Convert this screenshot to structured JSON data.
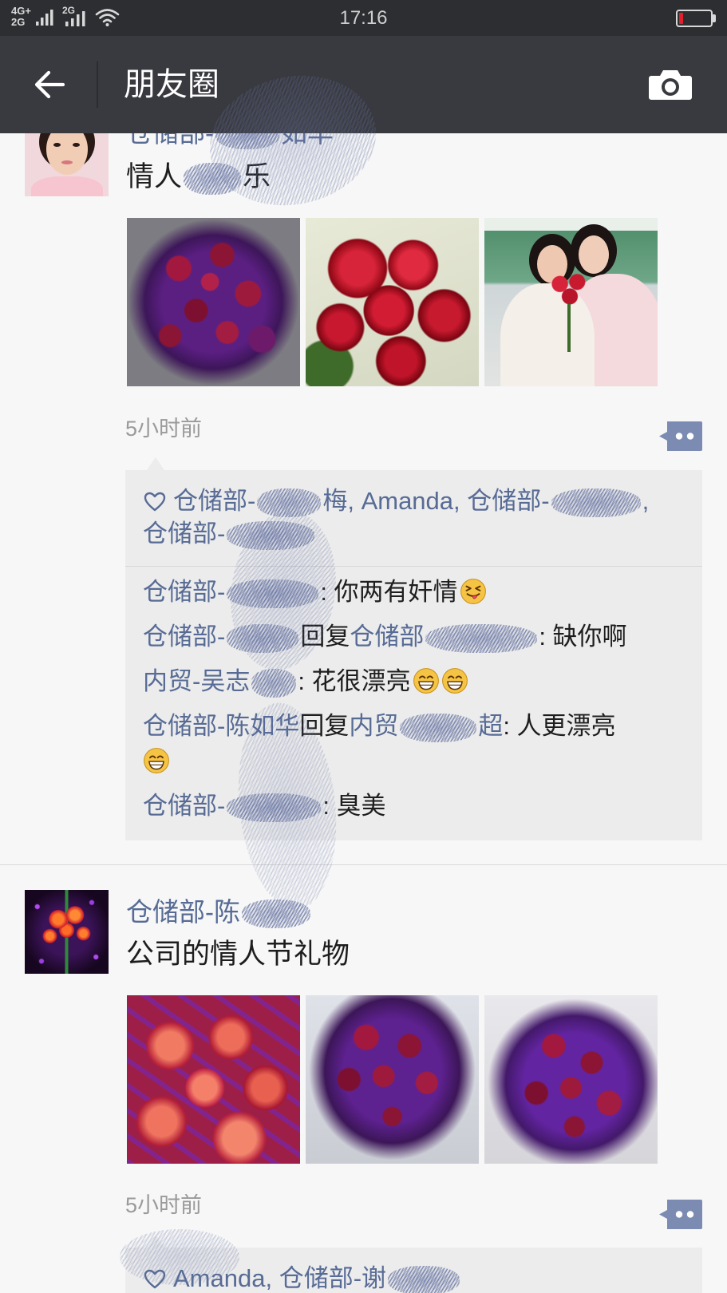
{
  "status_bar": {
    "network_primary": "4G+",
    "network_secondary": "2G",
    "network_sim2": "2G",
    "time": "17:16",
    "icons": [
      "signal-bars-icon",
      "signal-bars-icon",
      "wifi-icon",
      "battery-icon"
    ],
    "battery_level": 0.12
  },
  "nav": {
    "title": "朋友圈",
    "back_icon": "back-arrow-icon",
    "camera_icon": "camera-icon"
  },
  "colors": {
    "status_bar": "#2d2e32",
    "nav_bar": "#393a3f",
    "name_link": "#576b95",
    "comment_box": "#ececec",
    "comment_button": "#7b8bb2",
    "battery_low": "#e0202a"
  },
  "posts": [
    {
      "name_head": "仓储部-",
      "name_tail": "如华",
      "caption_head": "情人",
      "caption_tail": "乐",
      "time": "5小时前",
      "likes": {
        "icon": "heart-outline-icon",
        "separator": ", ",
        "names": [
          {
            "head": "仓储部-",
            "tail": "梅"
          },
          {
            "head": "Amanda"
          },
          {
            "head": "仓储部-"
          },
          {
            "head": "仓储部-"
          }
        ]
      },
      "comments": [
        {
          "from": "仓储部-",
          "body": ": 你两有奸情",
          "emoji": [
            "squint-tongue-emoji"
          ]
        },
        {
          "from": "仓储部-",
          "reply_word": "回复",
          "to": "仓储部",
          "body": ": 缺你啊"
        },
        {
          "from": "内贸-吴志",
          "body": ": 花很漂亮",
          "emoji": [
            "grin-emoji",
            "grin-emoji"
          ]
        },
        {
          "from": "仓储部-陈如华",
          "reply_word": "回复",
          "to": "内贸",
          "to_tail": "超",
          "body": ": 人更漂亮",
          "emoji": [
            "grin-emoji"
          ]
        },
        {
          "from": "仓储部-",
          "body": ": 臭美"
        }
      ]
    },
    {
      "name_head": "仓储部-陈",
      "caption": "公司的情人节礼物",
      "time": "5小时前",
      "likes": {
        "icon": "heart-outline-icon",
        "separator": ", ",
        "names": [
          {
            "head": "Amanda"
          },
          {
            "head": "仓储部-谢"
          }
        ]
      }
    }
  ]
}
